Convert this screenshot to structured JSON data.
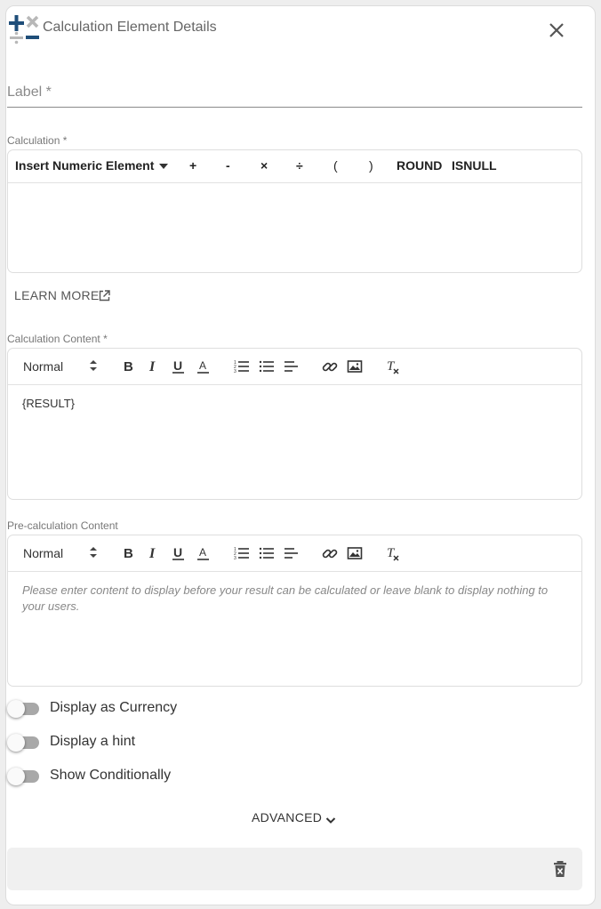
{
  "header": {
    "title": "Calculation Element Details",
    "logo_icon": "calculation-logo-icon",
    "close_icon": "close-icon"
  },
  "label_field": {
    "placeholder": "Label *",
    "value": ""
  },
  "calculation": {
    "caption": "Calculation *",
    "insert_element_label": "Insert Numeric Element",
    "operators": [
      "+",
      "-",
      "×",
      "÷",
      "(",
      ")",
      "ROUND",
      "ISNULL"
    ],
    "value": ""
  },
  "learn_more": {
    "label": "LEARN MORE",
    "icon": "external-link-icon"
  },
  "calc_content": {
    "caption": "Calculation Content *",
    "format": "Normal",
    "body": "{RESULT}"
  },
  "pre_calc_content": {
    "caption": "Pre-calculation Content",
    "format": "Normal",
    "placeholder": "Please enter content to display before your result can be calculated or leave blank to display nothing to your users."
  },
  "editor_toolbar_icons": [
    "bold-icon",
    "italic-icon",
    "underline-icon",
    "font-color-icon",
    "ordered-list-icon",
    "bullet-list-icon",
    "align-icon",
    "link-icon",
    "image-icon",
    "clear-format-icon"
  ],
  "toggles": [
    {
      "label": "Display as Currency",
      "on": false
    },
    {
      "label": "Display a hint",
      "on": false
    },
    {
      "label": "Show Conditionally",
      "on": false
    }
  ],
  "advanced": {
    "label": "ADVANCED",
    "icon": "chevron-down-icon"
  },
  "footer": {
    "delete_icon": "trash-icon"
  },
  "colors": {
    "brand_blue": "#1f4e79",
    "logo_gray": "#b8b8b8",
    "toggle_off": "#a8a8a8"
  }
}
